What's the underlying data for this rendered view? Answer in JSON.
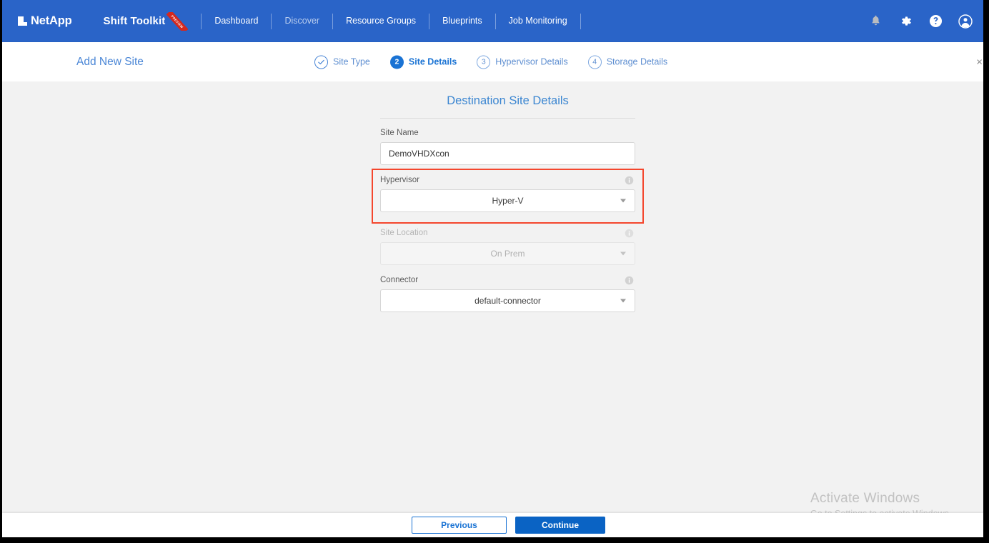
{
  "colors": {
    "nav_blue": "#2a64c8",
    "accent_blue": "#1a73d4",
    "link_blue": "#4a86d6",
    "highlight_red": "#f4462d",
    "page_bg": "#f2f2f2"
  },
  "topnav": {
    "logo_text": "NetApp",
    "brand_title": "Shift Toolkit",
    "brand_ribbon": "PREVIEW",
    "items": [
      {
        "label": "Dashboard",
        "dim": false
      },
      {
        "label": "Discover",
        "dim": true
      },
      {
        "label": "Resource Groups",
        "dim": false
      },
      {
        "label": "Blueprints",
        "dim": false
      },
      {
        "label": "Job Monitoring",
        "dim": false
      }
    ],
    "icons": [
      {
        "name": "notifications-bell-icon"
      },
      {
        "name": "settings-gear-icon"
      },
      {
        "name": "help-circle-icon"
      },
      {
        "name": "account-circle-icon"
      }
    ]
  },
  "wizard": {
    "title": "Add New Site",
    "close_label": "×",
    "steps": [
      {
        "badge": "✓",
        "label": "Site Type",
        "state": "done"
      },
      {
        "badge": "2",
        "label": "Site Details",
        "state": "active"
      },
      {
        "badge": "3",
        "label": "Hypervisor Details",
        "state": "pending"
      },
      {
        "badge": "4",
        "label": "Storage Details",
        "state": "pending"
      }
    ]
  },
  "form": {
    "heading": "Destination Site Details",
    "site_name": {
      "label": "Site Name",
      "value": "DemoVHDXcon",
      "placeholder": "Site Name"
    },
    "hypervisor": {
      "label": "Hypervisor",
      "value": "Hyper-V",
      "highlighted": true
    },
    "site_location": {
      "label": "Site Location",
      "value": "On Prem",
      "disabled": true
    },
    "connector": {
      "label": "Connector",
      "value": "default-connector"
    }
  },
  "footer": {
    "previous_label": "Previous",
    "continue_label": "Continue"
  },
  "watermark": {
    "title": "Activate Windows",
    "subtitle": "Go to Settings to activate Windows."
  }
}
